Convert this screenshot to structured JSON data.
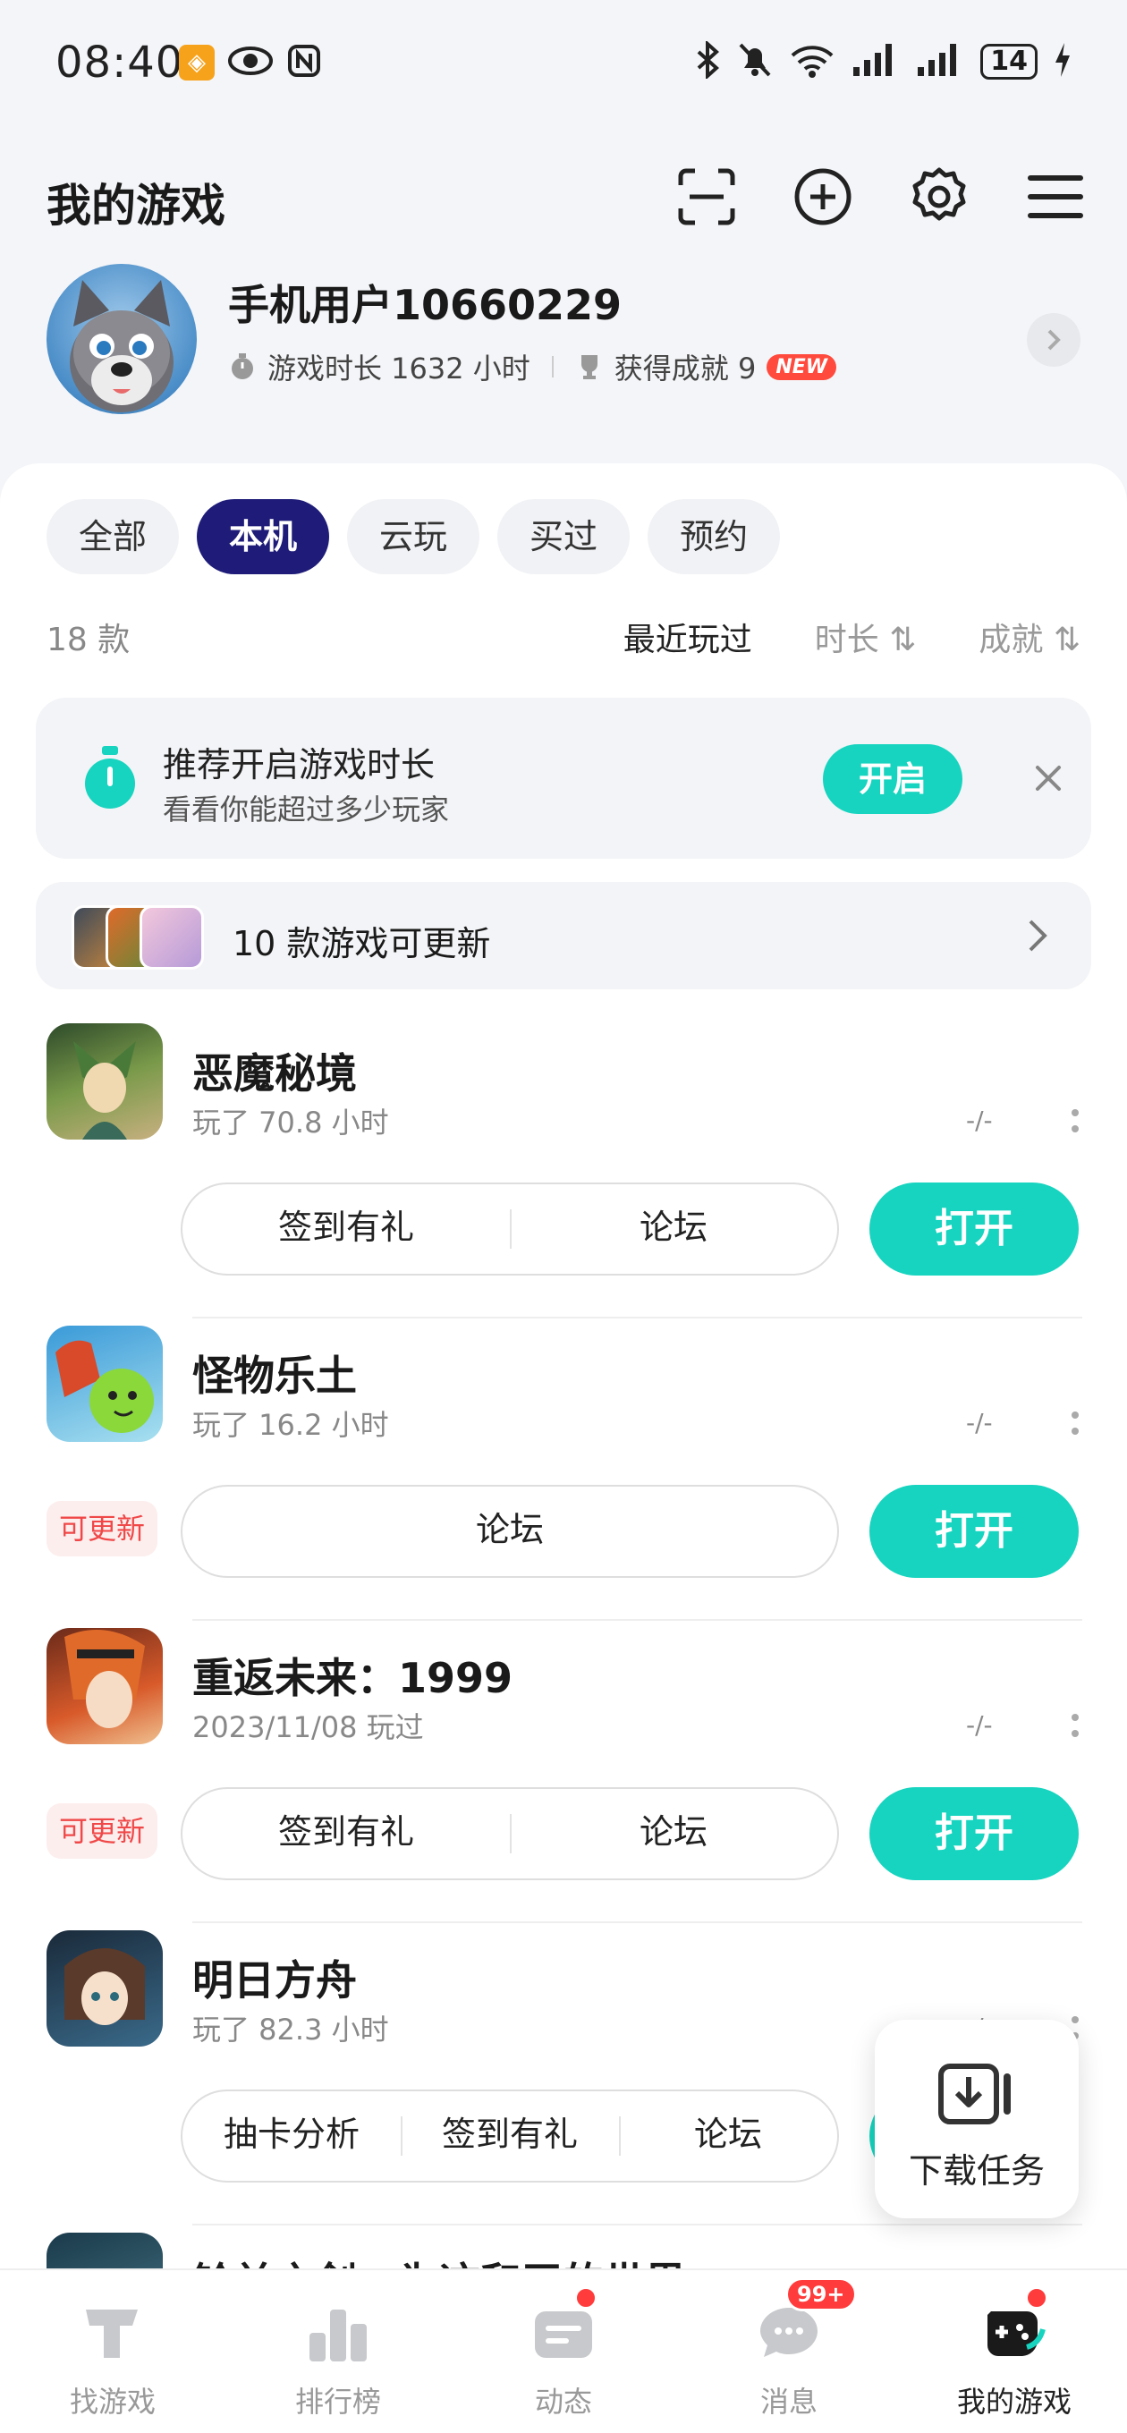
{
  "status_bar": {
    "time": "08:40",
    "battery": "14"
  },
  "header": {
    "title": "我的游戏"
  },
  "profile": {
    "username": "手机用户10660229",
    "playtime_label": "游戏时长 1632 小时",
    "achievements_label": "获得成就 9",
    "new_badge": "NEW"
  },
  "filters": [
    {
      "label": "全部",
      "active": false
    },
    {
      "label": "本机",
      "active": true
    },
    {
      "label": "云玩",
      "active": false
    },
    {
      "label": "买过",
      "active": false
    },
    {
      "label": "预约",
      "active": false
    }
  ],
  "sortbar": {
    "count": "18 款",
    "options": [
      "最近玩过",
      "时长 ⇅",
      "成就 ⇅"
    ]
  },
  "tip": {
    "title": "推荐开启游戏时长",
    "subtitle": "看看你能超过多少玩家",
    "button": "开启"
  },
  "update_banner": {
    "text": "10 款游戏可更新"
  },
  "games": [
    {
      "name": "恶魔秘境",
      "subtitle": "玩了 70.8 小时",
      "rank": "-/-",
      "update_tag": "",
      "buttons": [
        "签到有礼",
        "论坛"
      ],
      "open": "打开"
    },
    {
      "name": "怪物乐土",
      "subtitle": "玩了 16.2 小时",
      "rank": "-/-",
      "update_tag": "可更新",
      "buttons": [
        "论坛"
      ],
      "open": "打开"
    },
    {
      "name": "重返未来：1999",
      "subtitle": "2023/11/08 玩过",
      "rank": "-/-",
      "update_tag": "可更新",
      "buttons": [
        "签到有礼",
        "论坛"
      ],
      "open": "打开"
    },
    {
      "name": "明日方舟",
      "subtitle": "玩了 82.3 小时",
      "rank": "-/-",
      "update_tag": "",
      "buttons": [
        "抽卡分析",
        "签到有礼",
        "论坛"
      ],
      "open": "打开"
    },
    {
      "name": "铃兰之剑：为这和平的世界",
      "subtitle": "",
      "rank": "",
      "update_tag": "",
      "buttons": [],
      "open": ""
    }
  ],
  "download_card": {
    "label": "下载任务"
  },
  "bottom_nav": [
    {
      "label": "找游戏",
      "active": false
    },
    {
      "label": "排行榜",
      "active": false
    },
    {
      "label": "动态",
      "active": false
    },
    {
      "label": "消息",
      "active": false,
      "badge": "99+"
    },
    {
      "label": "我的游戏",
      "active": true
    }
  ],
  "colors": {
    "accent": "#16d4bf",
    "chip_active": "#1e1c78",
    "update_red": "#f04848"
  }
}
